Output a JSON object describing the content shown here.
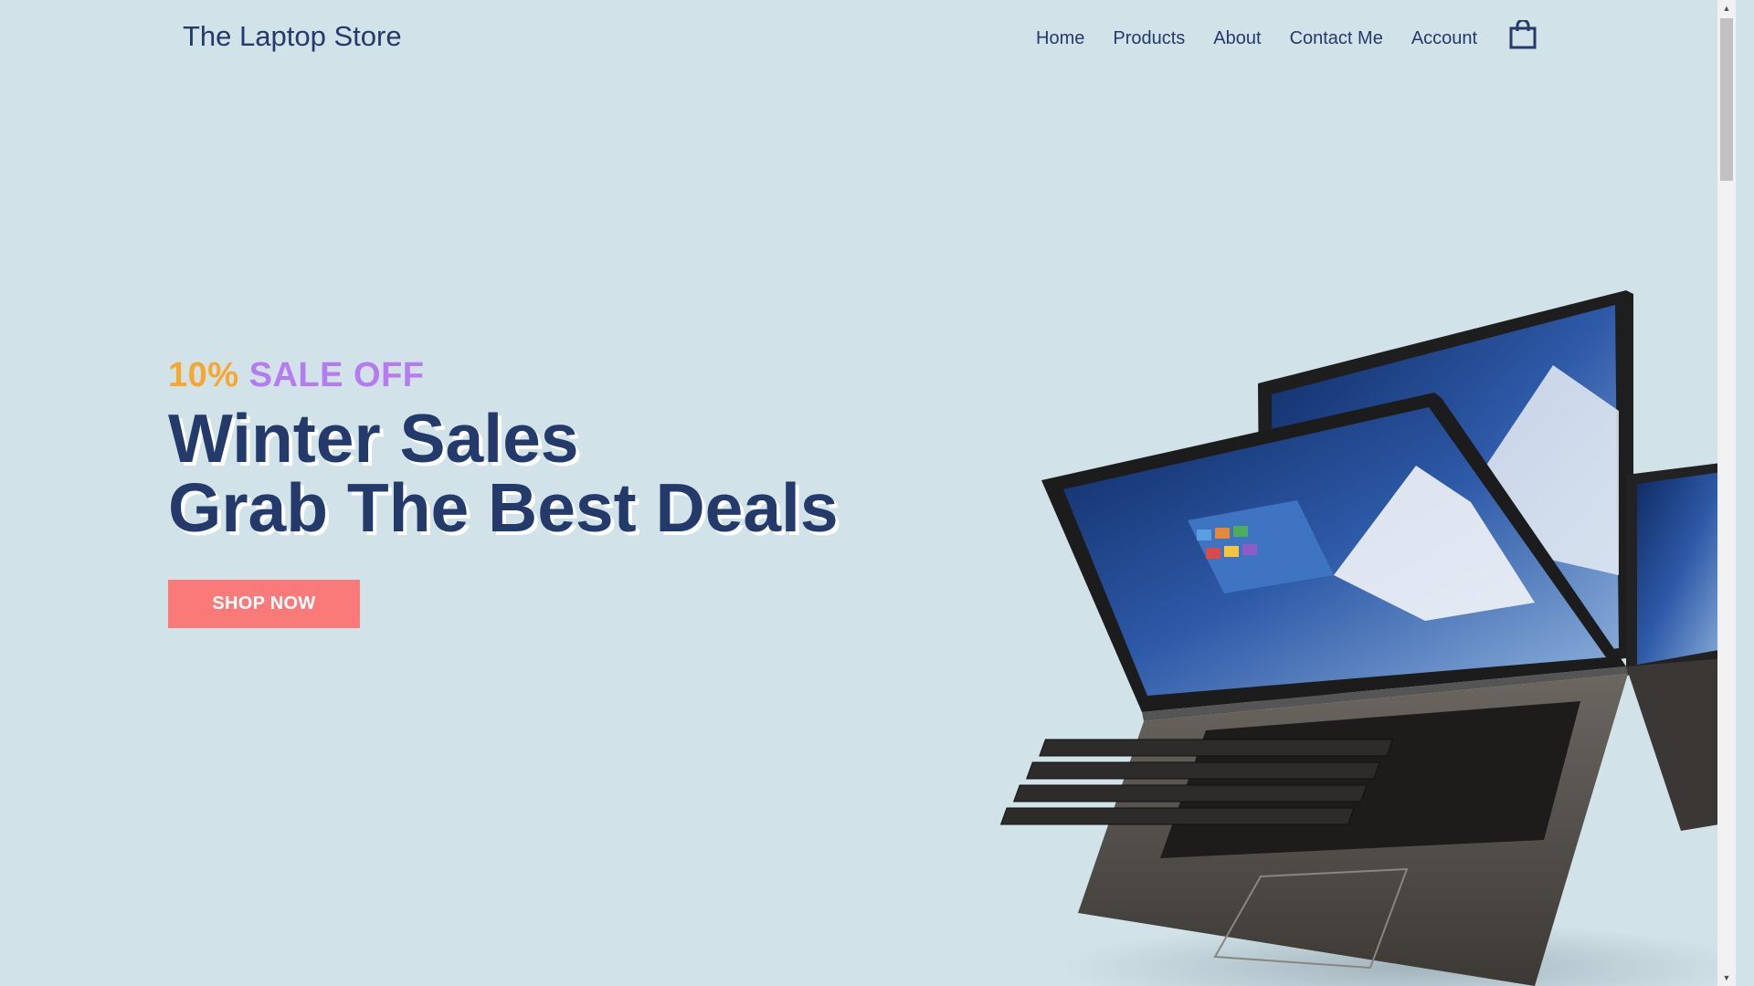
{
  "header": {
    "brand": "The Laptop Store",
    "nav": [
      "Home",
      "Products",
      "About",
      "Contact Me",
      "Account"
    ],
    "cart_icon": "shopping-bag-icon"
  },
  "hero": {
    "promo_percent": "10%",
    "promo_text": "SALE OFF",
    "headline_line1": "Winter Sales",
    "headline_line2": "Grab The Best Deals",
    "cta_label": "SHOP NOW",
    "image_icon": "convertible-laptop-illustration"
  },
  "colors": {
    "background": "#d1e2e9",
    "primary_text": "#233a6b",
    "promo_percent": "#f6a82e",
    "promo_text": "#b67bf1",
    "cta_background": "#fa7a7a",
    "cta_text": "#ffffff"
  }
}
